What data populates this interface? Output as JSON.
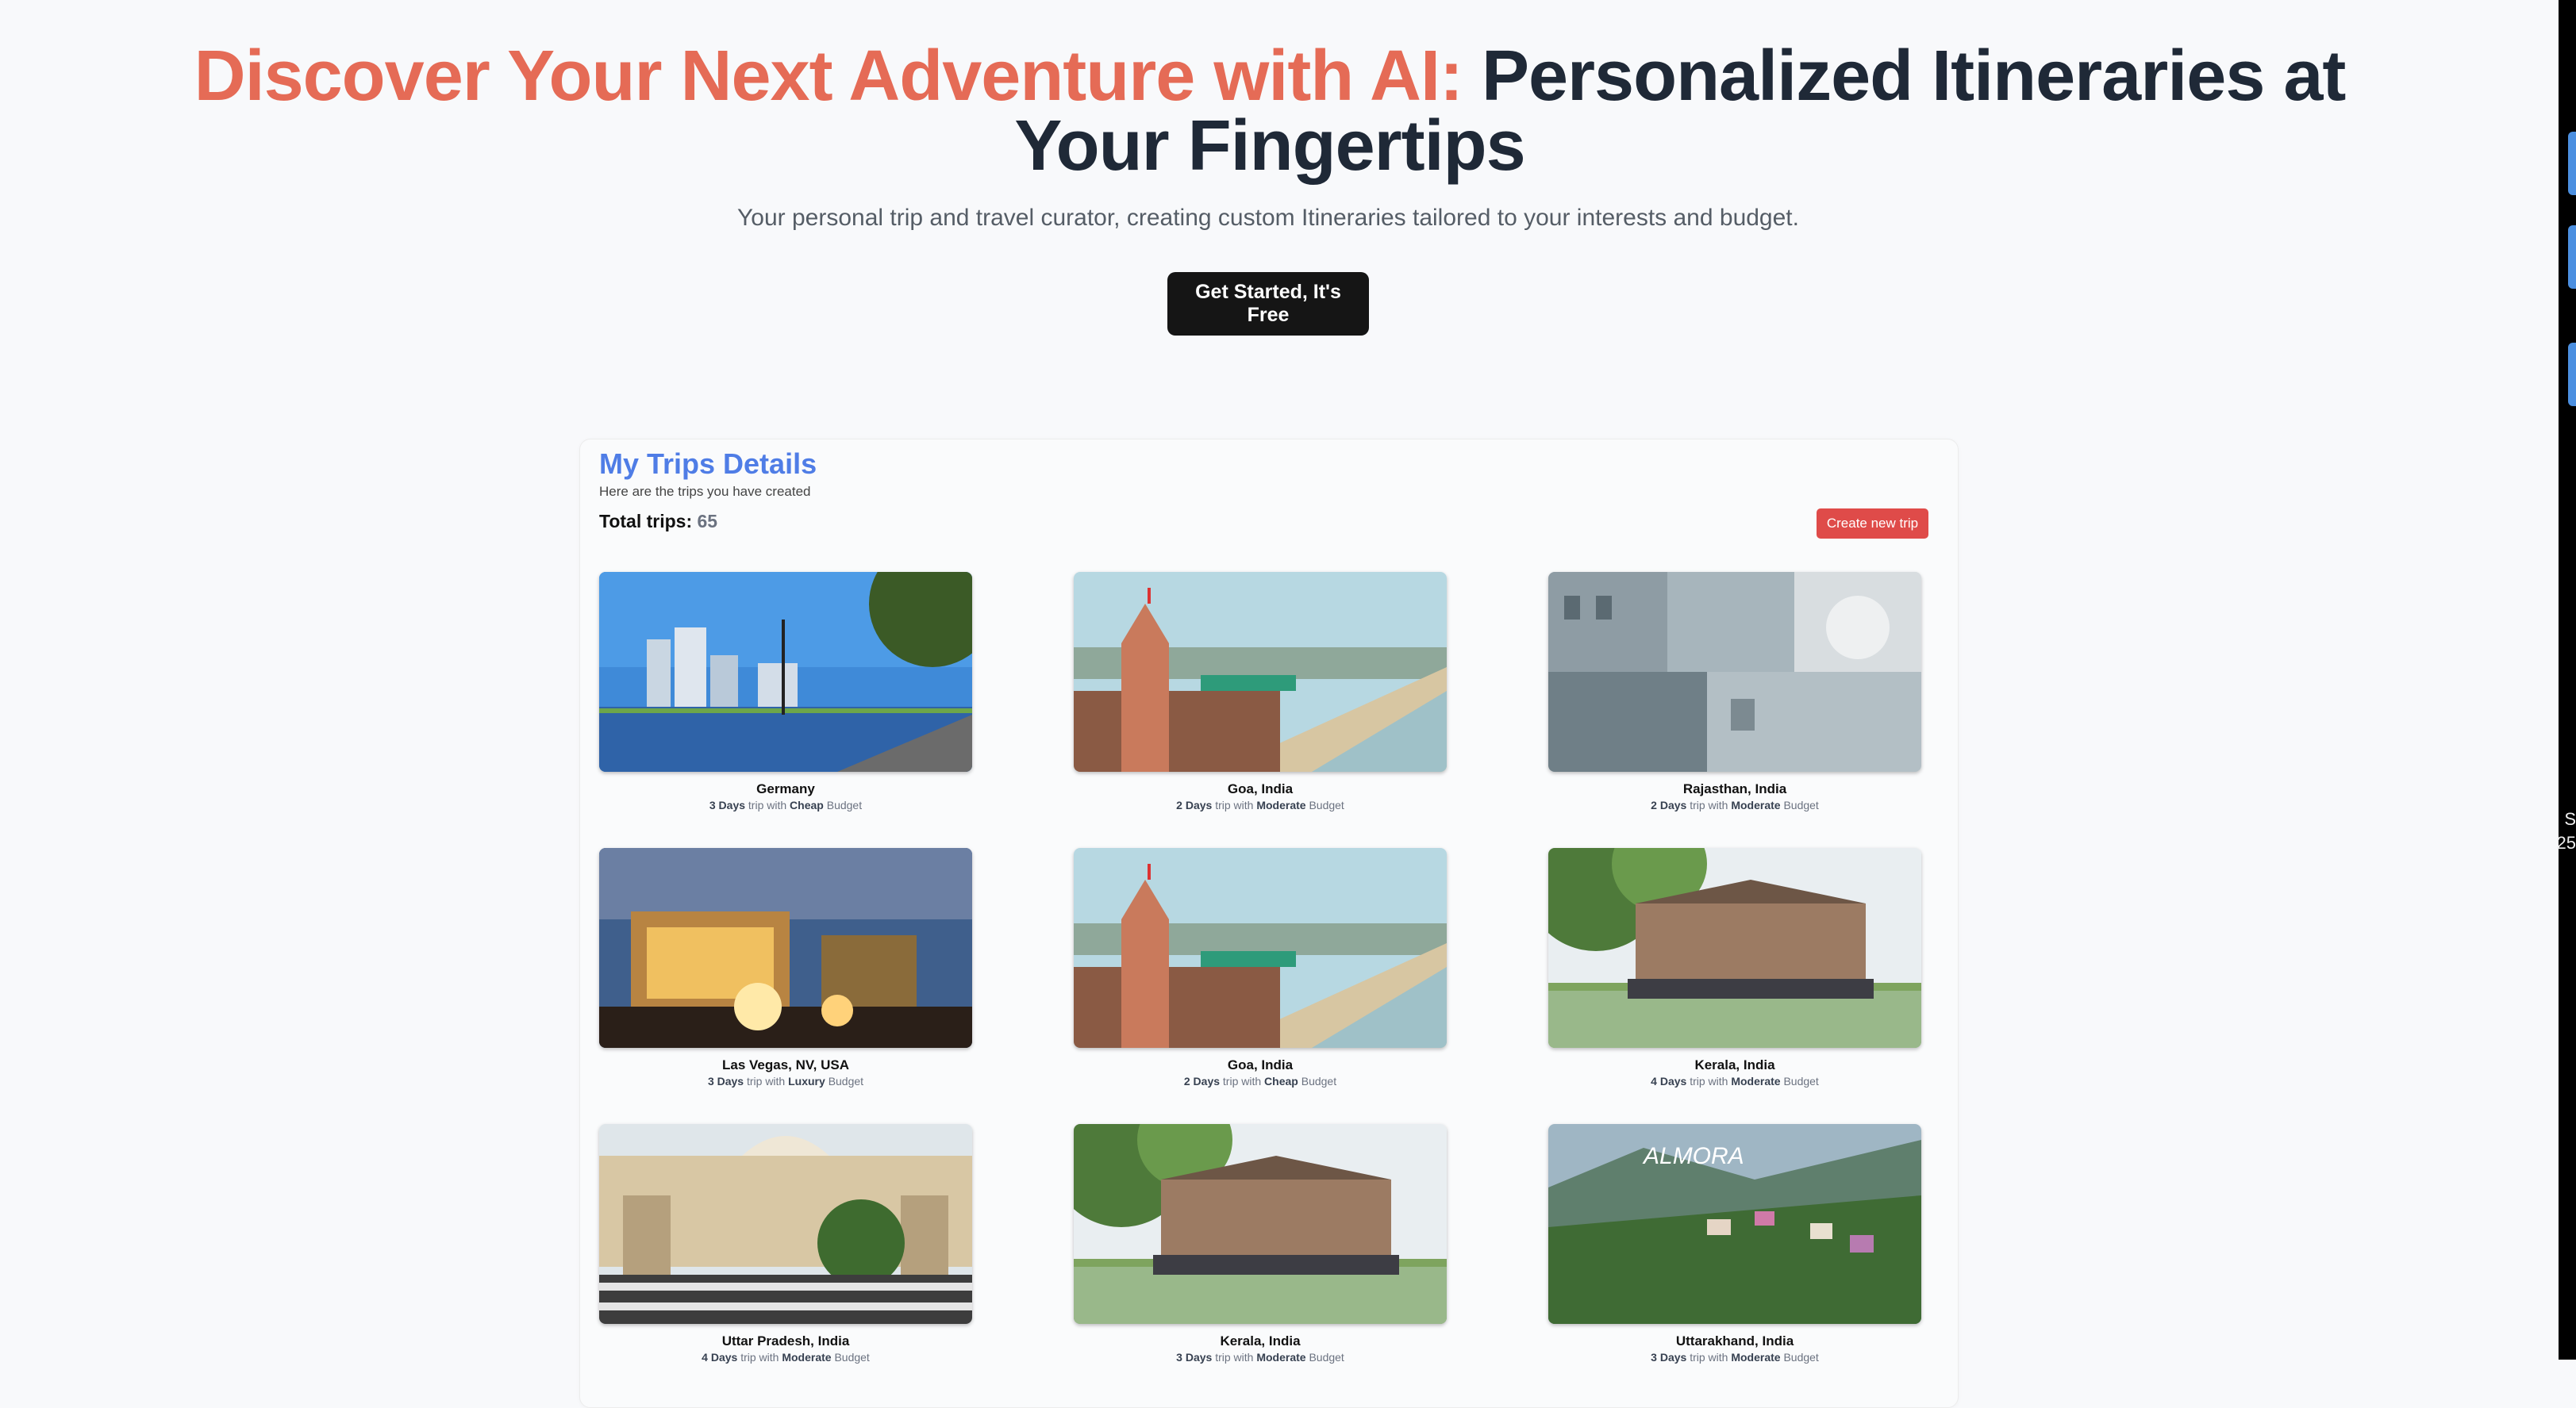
{
  "hero": {
    "title_accent": "Discover Your Next Adventure with AI:",
    "title_rest": "Personalized Itineraries at Your Fingertips",
    "subtitle": "Your personal trip and travel curator, creating custom Itineraries tailored to your interests and budget.",
    "cta_label": "Get Started, It's Free"
  },
  "trips": {
    "title": "My Trips Details",
    "subtitle": "Here are the trips you have created",
    "total_label": "Total trips:",
    "total_count": "65",
    "create_label": "Create new trip",
    "trip_word": "trip with",
    "budget_word": "Budget",
    "items": [
      {
        "name": "Germany",
        "days": "3 Days",
        "budget": "Cheap",
        "image": "city-river"
      },
      {
        "name": "Goa, India",
        "days": "2 Days",
        "budget": "Moderate",
        "image": "beach-temple"
      },
      {
        "name": "Rajasthan, India",
        "days": "2 Days",
        "budget": "Moderate",
        "image": "rajasthan-collage"
      },
      {
        "name": "Las Vegas, NV, USA",
        "days": "3 Days",
        "budget": "Luxury",
        "image": "vegas-night"
      },
      {
        "name": "Goa, India",
        "days": "2 Days",
        "budget": "Cheap",
        "image": "beach-temple"
      },
      {
        "name": "Kerala, India",
        "days": "4 Days",
        "budget": "Moderate",
        "image": "houseboat"
      },
      {
        "name": "Uttar Pradesh, India",
        "days": "4 Days",
        "budget": "Moderate",
        "image": "temple-courtyard"
      },
      {
        "name": "Kerala, India",
        "days": "3 Days",
        "budget": "Moderate",
        "image": "houseboat"
      },
      {
        "name": "Uttarakhand, India",
        "days": "3 Days",
        "budget": "Moderate",
        "image": "hill-town"
      }
    ]
  },
  "edge": {
    "letter1": "S",
    "letter2": "25"
  },
  "colors": {
    "accent": "#e56b56",
    "heading": "#1f2937",
    "link_blue": "#4f7de6",
    "danger": "#df4b49",
    "cta_bg": "#151515"
  }
}
